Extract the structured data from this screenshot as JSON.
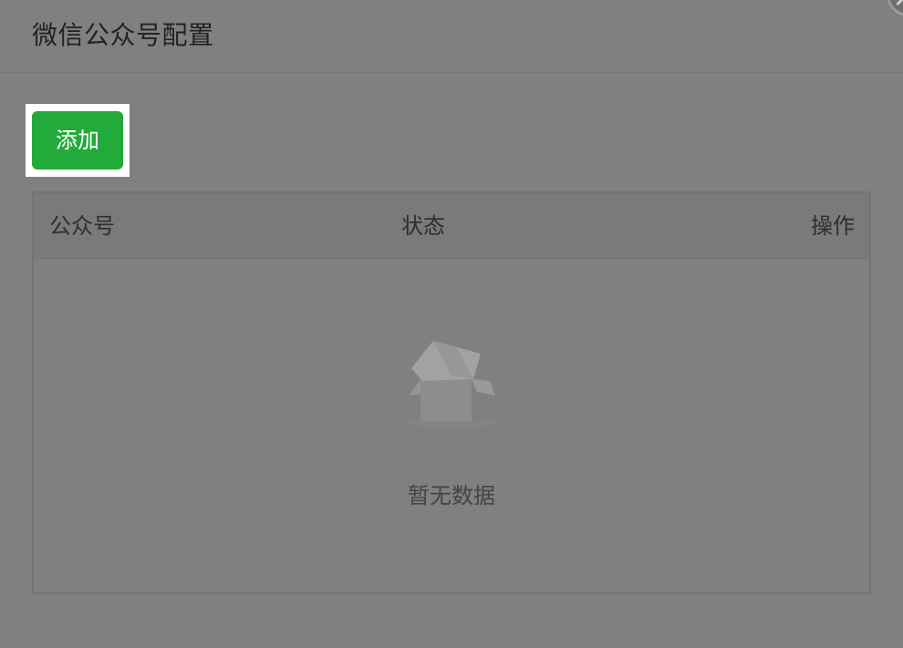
{
  "dialog": {
    "title": "微信公众号配置"
  },
  "toolbar": {
    "add_label": "添加"
  },
  "table": {
    "columns": [
      "公众号",
      "状态",
      "操作"
    ],
    "rows": [],
    "empty_text": "暂无数据"
  },
  "icons": {
    "close": "close-icon",
    "empty": "empty-box-icon"
  },
  "colors": {
    "overlay": "#808080",
    "primary_button": "#22aa3a",
    "highlight": "#ffffff"
  }
}
